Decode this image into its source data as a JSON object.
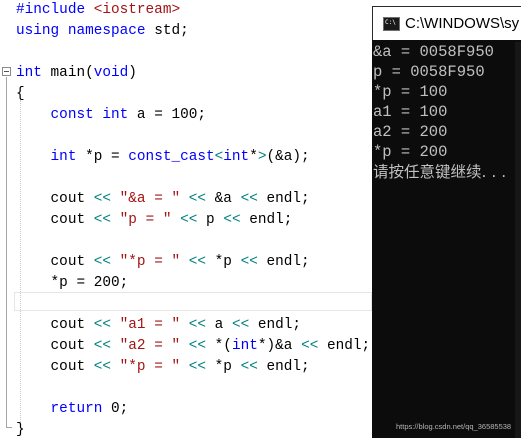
{
  "editor": {
    "lines": [
      [
        {
          "t": "#include ",
          "c": "kw"
        },
        {
          "t": "<iostream>",
          "c": "inc"
        }
      ],
      [
        {
          "t": "using ",
          "c": "kw"
        },
        {
          "t": "namespace ",
          "c": "kw"
        },
        {
          "t": "std;",
          "c": "id"
        }
      ],
      [],
      [
        {
          "t": "int ",
          "c": "kw"
        },
        {
          "t": "main(",
          "c": "id"
        },
        {
          "t": "void",
          "c": "kw"
        },
        {
          "t": ")",
          "c": "id"
        }
      ],
      [
        {
          "t": "{",
          "c": "id"
        }
      ],
      [
        {
          "t": "    ",
          "c": "id"
        },
        {
          "t": "const ",
          "c": "kw"
        },
        {
          "t": "int ",
          "c": "kw"
        },
        {
          "t": "a = 100;",
          "c": "id"
        }
      ],
      [],
      [
        {
          "t": "    ",
          "c": "id"
        },
        {
          "t": "int ",
          "c": "kw"
        },
        {
          "t": "*p = ",
          "c": "id"
        },
        {
          "t": "const_cast",
          "c": "kw"
        },
        {
          "t": "<",
          "c": "op"
        },
        {
          "t": "int",
          "c": "kw"
        },
        {
          "t": "*",
          "c": "id"
        },
        {
          "t": ">",
          "c": "op"
        },
        {
          "t": "(&a);",
          "c": "id"
        }
      ],
      [],
      [
        {
          "t": "    cout ",
          "c": "id"
        },
        {
          "t": "<< ",
          "c": "op"
        },
        {
          "t": "\"&a = \" ",
          "c": "str"
        },
        {
          "t": "<< ",
          "c": "op"
        },
        {
          "t": "&a ",
          "c": "id"
        },
        {
          "t": "<< ",
          "c": "op"
        },
        {
          "t": "endl;",
          "c": "id"
        }
      ],
      [
        {
          "t": "    cout ",
          "c": "id"
        },
        {
          "t": "<< ",
          "c": "op"
        },
        {
          "t": "\"p = \" ",
          "c": "str"
        },
        {
          "t": "<< ",
          "c": "op"
        },
        {
          "t": "p ",
          "c": "id"
        },
        {
          "t": "<< ",
          "c": "op"
        },
        {
          "t": "endl;",
          "c": "id"
        }
      ],
      [],
      [
        {
          "t": "    cout ",
          "c": "id"
        },
        {
          "t": "<< ",
          "c": "op"
        },
        {
          "t": "\"*p = \" ",
          "c": "str"
        },
        {
          "t": "<< ",
          "c": "op"
        },
        {
          "t": "*p ",
          "c": "id"
        },
        {
          "t": "<< ",
          "c": "op"
        },
        {
          "t": "endl;",
          "c": "id"
        }
      ],
      [
        {
          "t": "    *p = 200;",
          "c": "id"
        }
      ],
      [],
      [
        {
          "t": "    cout ",
          "c": "id"
        },
        {
          "t": "<< ",
          "c": "op"
        },
        {
          "t": "\"a1 = \" ",
          "c": "str"
        },
        {
          "t": "<< ",
          "c": "op"
        },
        {
          "t": "a ",
          "c": "id"
        },
        {
          "t": "<< ",
          "c": "op"
        },
        {
          "t": "endl;",
          "c": "id"
        }
      ],
      [
        {
          "t": "    cout ",
          "c": "id"
        },
        {
          "t": "<< ",
          "c": "op"
        },
        {
          "t": "\"a2 = \" ",
          "c": "str"
        },
        {
          "t": "<< ",
          "c": "op"
        },
        {
          "t": "*(",
          "c": "id"
        },
        {
          "t": "int",
          "c": "kw"
        },
        {
          "t": "*)&a ",
          "c": "id"
        },
        {
          "t": "<< ",
          "c": "op"
        },
        {
          "t": "endl;",
          "c": "id"
        }
      ],
      [
        {
          "t": "    cout ",
          "c": "id"
        },
        {
          "t": "<< ",
          "c": "op"
        },
        {
          "t": "\"*p = \" ",
          "c": "str"
        },
        {
          "t": "<< ",
          "c": "op"
        },
        {
          "t": "*p ",
          "c": "id"
        },
        {
          "t": "<< ",
          "c": "op"
        },
        {
          "t": "endl;",
          "c": "id"
        }
      ],
      [],
      [
        {
          "t": "    ",
          "c": "id"
        },
        {
          "t": "return ",
          "c": "kw"
        },
        {
          "t": "0;",
          "c": "id"
        }
      ],
      [
        {
          "t": "}",
          "c": "id"
        }
      ]
    ],
    "colors": {
      "keyword": "#0000ff",
      "string": "#a31515",
      "operator": "#008080",
      "text": "#000000",
      "background": "#ffffff"
    }
  },
  "console": {
    "title": "C:\\WINDOWS\\sy",
    "icon": "console-app-icon",
    "output": [
      "&a = 0058F950",
      "p = 0058F950",
      "*p = 100",
      "a1 = 100",
      "a2 = 200",
      "*p = 200"
    ],
    "prompt": "请按任意键继续. . .",
    "watermark": "https://blog.csdn.net/qq_36585538",
    "colors": {
      "background": "#0c0c0c",
      "text": "#c0c0c0"
    }
  }
}
